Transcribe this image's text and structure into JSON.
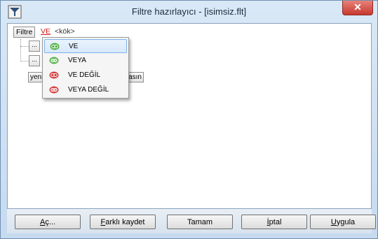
{
  "window": {
    "title": "Filtre hazırlayıcı - [isimsiz.flt]",
    "close_symbol": "✕"
  },
  "filter": {
    "button_label": "Filtre",
    "operator": "VE",
    "root_label": "<kök>"
  },
  "tree": {
    "placeholder_buttons": [
      "...",
      "..."
    ]
  },
  "partial_buttons": {
    "new_fragment": "yeni",
    "clear_fragment": "asın"
  },
  "operator_menu": {
    "items": [
      {
        "label": "VE",
        "selected": true,
        "icon": "and-icon",
        "color": "#4caf3f"
      },
      {
        "label": "VEYA",
        "selected": false,
        "icon": "or-icon",
        "color": "#4caf3f"
      },
      {
        "label": "VE DEĞİL",
        "selected": false,
        "icon": "and-not-icon",
        "color": "#d23a3a"
      },
      {
        "label": "VEYA DEĞİL",
        "selected": false,
        "icon": "or-not-icon",
        "color": "#d23a3a"
      }
    ]
  },
  "footer": {
    "open": {
      "accel": "A",
      "rest": "ç..."
    },
    "save_as": {
      "accel": "F",
      "rest": "arklı kaydet"
    },
    "ok": "Tamam",
    "cancel": {
      "accel": "İ",
      "rest": "ptal"
    },
    "apply": {
      "accel": "U",
      "rest": "ygula"
    }
  }
}
